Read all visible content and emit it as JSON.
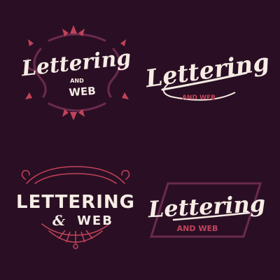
{
  "colors": {
    "background": "#2a0f24",
    "cream": "#f6ece4",
    "rose": "#c2435a",
    "plum": "#6b2a4e",
    "dark_plum": "#3a1530"
  },
  "logos": [
    {
      "title": "Lettering",
      "and": "AND",
      "subtitle": "WEB"
    },
    {
      "title": "Lettering",
      "subtitle": "AND WEB"
    },
    {
      "title": "LETTERING",
      "amp": "&",
      "subtitle": "WEB"
    },
    {
      "title": "Lettering",
      "subtitle": "AND WEB"
    }
  ]
}
